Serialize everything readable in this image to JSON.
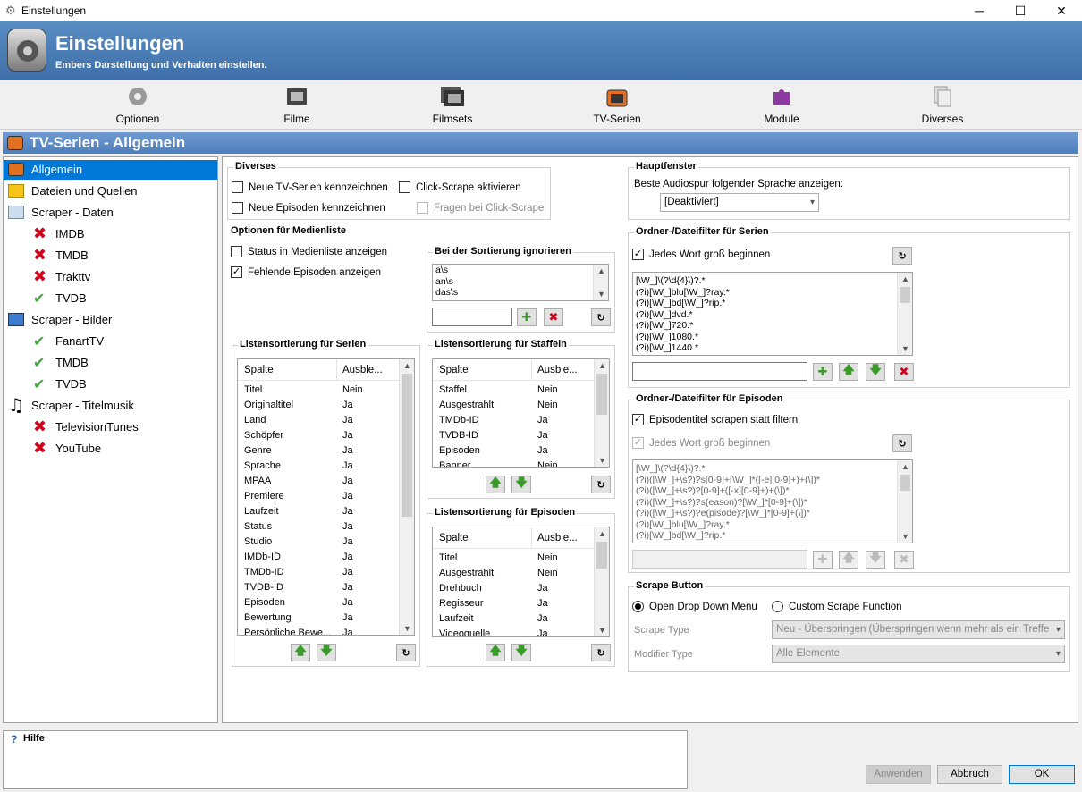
{
  "window": {
    "title": "Einstellungen",
    "min": "─",
    "max": "☐",
    "close": "✕"
  },
  "header": {
    "title": "Einstellungen",
    "subtitle": "Embers Darstellung und Verhalten einstellen."
  },
  "toolbar": {
    "items": [
      {
        "label": "Optionen",
        "icon": "gear-icon"
      },
      {
        "label": "Filme",
        "icon": "film-icon"
      },
      {
        "label": "Filmsets",
        "icon": "film-set-icon"
      },
      {
        "label": "TV-Serien",
        "icon": "tv-icon"
      },
      {
        "label": "Module",
        "icon": "puzzle-icon"
      },
      {
        "label": "Diverses",
        "icon": "documents-icon"
      }
    ]
  },
  "section": {
    "title": "TV-Serien - Allgemein"
  },
  "tree": {
    "items": [
      {
        "label": "Allgemein",
        "icon": "tv-icon"
      },
      {
        "label": "Dateien und Quellen",
        "icon": "folder-icon"
      },
      {
        "label": "Scraper - Daten",
        "icon": "data-icon"
      },
      {
        "label": "IMDB",
        "icon": "x-icon"
      },
      {
        "label": "TMDB",
        "icon": "x-icon"
      },
      {
        "label": "Trakttv",
        "icon": "x-icon"
      },
      {
        "label": "TVDB",
        "icon": "check-icon"
      },
      {
        "label": "Scraper - Bilder",
        "icon": "image-icon"
      },
      {
        "label": "FanartTV",
        "icon": "check-icon"
      },
      {
        "label": "TMDB",
        "icon": "check-icon"
      },
      {
        "label": "TVDB",
        "icon": "check-icon"
      },
      {
        "label": "Scraper - Titelmusik",
        "icon": "music-icon"
      },
      {
        "label": "TelevisionTunes",
        "icon": "x-icon"
      },
      {
        "label": "YouTube",
        "icon": "x-icon"
      }
    ]
  },
  "diverses": {
    "title": "Diverses",
    "new_series": "Neue TV-Serien kennzeichnen",
    "click_scrape": "Click-Scrape aktivieren",
    "new_episodes": "Neue Episoden kennzeichnen",
    "ask_click_scrape": "Fragen bei Click-Scrape"
  },
  "medialist": {
    "title": "Optionen für Medienliste",
    "status": "Status in Medienliste anzeigen",
    "missing": "Fehlende Episoden anzeigen"
  },
  "sort_ignore": {
    "title": "Bei der Sortierung ignorieren",
    "values": [
      "a\\s",
      "an\\s",
      "das\\s"
    ]
  },
  "series_sort": {
    "title": "Listensortierung für Serien",
    "col1": "Spalte",
    "col2": "Ausble...",
    "rows": [
      [
        "Titel",
        "Nein"
      ],
      [
        "Originaltitel",
        "Ja"
      ],
      [
        "Land",
        "Ja"
      ],
      [
        "Schöpfer",
        "Ja"
      ],
      [
        "Genre",
        "Ja"
      ],
      [
        "Sprache",
        "Ja"
      ],
      [
        "MPAA",
        "Ja"
      ],
      [
        "Premiere",
        "Ja"
      ],
      [
        "Laufzeit",
        "Ja"
      ],
      [
        "Status",
        "Ja"
      ],
      [
        "Studio",
        "Ja"
      ],
      [
        "IMDb-ID",
        "Ja"
      ],
      [
        "TMDb-ID",
        "Ja"
      ],
      [
        "TVDB-ID",
        "Ja"
      ],
      [
        "Episoden",
        "Ja"
      ],
      [
        "Bewertung",
        "Ja"
      ],
      [
        "Persönliche Bewe...",
        "Ja"
      ]
    ]
  },
  "season_sort": {
    "title": "Listensortierung für Staffeln",
    "col1": "Spalte",
    "col2": "Ausble...",
    "rows": [
      [
        "Staffel",
        "Nein"
      ],
      [
        "Ausgestrahlt",
        "Nein"
      ],
      [
        "TMDb-ID",
        "Ja"
      ],
      [
        "TVDB-ID",
        "Ja"
      ],
      [
        "Episoden",
        "Ja"
      ],
      [
        "Banner",
        "Nein"
      ]
    ]
  },
  "episode_sort": {
    "title": "Listensortierung für Episoden",
    "col1": "Spalte",
    "col2": "Ausble...",
    "rows": [
      [
        "Titel",
        "Nein"
      ],
      [
        "Ausgestrahlt",
        "Nein"
      ],
      [
        "Drehbuch",
        "Ja"
      ],
      [
        "Regisseur",
        "Ja"
      ],
      [
        "Laufzeit",
        "Ja"
      ],
      [
        "Videoquelle",
        "Ja"
      ]
    ]
  },
  "mainwindow": {
    "title": "Hauptfenster",
    "label": "Beste Audiospur folgender Sprache anzeigen:",
    "value": "[Deaktiviert]"
  },
  "series_filter": {
    "title": "Ordner-/Dateifilter für Serien",
    "cap": "Jedes Wort groß beginnen",
    "lines": [
      "[\\W_]\\(?\\d{4}\\)?.*",
      "(?i)[\\W_]blu[\\W_]?ray.*",
      "(?i)[\\W_]bd[\\W_]?rip.*",
      "(?i)[\\W_]dvd.*",
      "(?i)[\\W_]720.*",
      "(?i)[\\W_]1080.*",
      "(?i)[\\W_]1440.*"
    ]
  },
  "episode_filter": {
    "title": "Ordner-/Dateifilter für Episoden",
    "scrape_title": "Episodentitel scrapen statt filtern",
    "cap": "Jedes Wort groß beginnen",
    "lines": [
      "[\\W_]\\(?\\d{4}\\)?.*",
      "(?i)([\\W_]+\\s?)?s[0-9]+[\\W_]*([-e][0-9]+)+(\\])*",
      "(?i)([\\W_]+\\s?)?[0-9]+([-x][0-9]+)+(\\])*",
      "(?i)([\\W_]+\\s?)?s(eason)?[\\W_]*[0-9]+(\\])*",
      "(?i)([\\W_]+\\s?)?e(pisode)?[\\W_]*[0-9]+(\\])*",
      "(?i)[\\W_]blu[\\W_]?ray.*",
      "(?i)[\\W_]bd[\\W_]?rip.*"
    ]
  },
  "scrape_button": {
    "title": "Scrape Button",
    "opt1": "Open Drop Down Menu",
    "opt2": "Custom Scrape Function",
    "type_label": "Scrape Type",
    "type_value": "Neu - Überspringen (Überspringen wenn mehr als ein Treffe",
    "mod_label": "Modifier Type",
    "mod_value": "Alle Elemente"
  },
  "help": {
    "title": "Hilfe"
  },
  "buttons": {
    "apply": "Anwenden",
    "cancel": "Abbruch",
    "ok": "OK"
  }
}
